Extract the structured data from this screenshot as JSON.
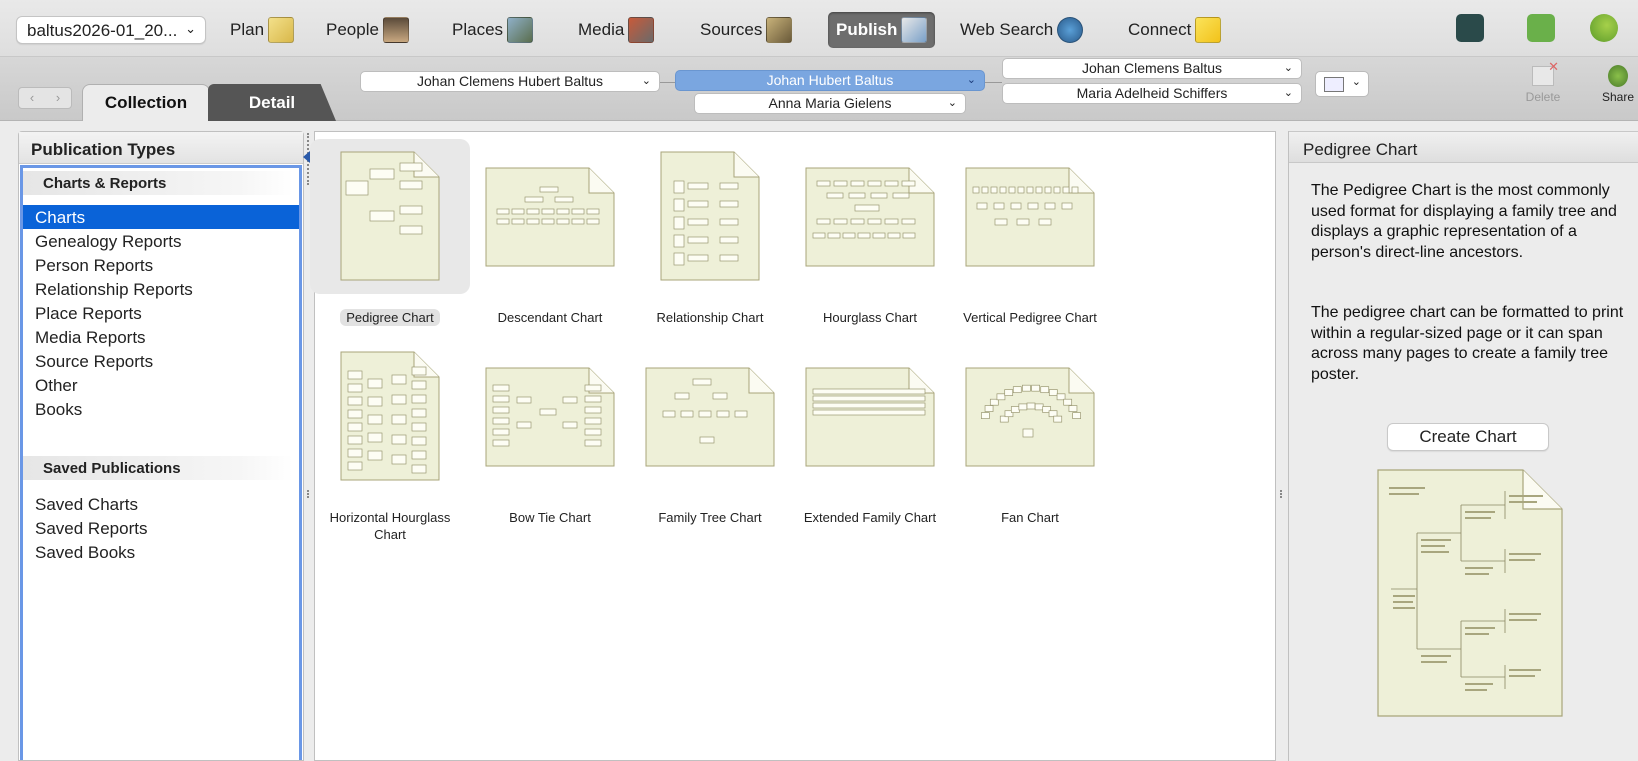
{
  "toolbar": {
    "file_name": "baltus2026-01_20...",
    "modules": [
      {
        "label": "Plan",
        "icon": "plan-icon"
      },
      {
        "label": "People",
        "icon": "people-icon"
      },
      {
        "label": "Places",
        "icon": "places-icon"
      },
      {
        "label": "Media",
        "icon": "media-icon"
      },
      {
        "label": "Sources",
        "icon": "sources-icon"
      },
      {
        "label": "Publish",
        "icon": "publish-icon",
        "active": true
      },
      {
        "label": "Web Search",
        "icon": "web-search-icon"
      },
      {
        "label": "Connect",
        "icon": "connect-icon"
      }
    ]
  },
  "subbar": {
    "tabs": [
      "Collection",
      "Detail"
    ],
    "active_tab": "Collection",
    "person_main": "Johan Hubert Baltus",
    "person_left": "Johan Clemens Hubert Baltus",
    "spouse": "Anna Maria Gielens",
    "father": "Johan Clemens Baltus",
    "mother": "Maria Adelheid Schiffers",
    "delete_label": "Delete",
    "share_label": "Share"
  },
  "publication_types": {
    "header": "Publication Types",
    "section1": "Charts & Reports",
    "items": [
      "Charts",
      "Genealogy Reports",
      "Person Reports",
      "Relationship Reports",
      "Place Reports",
      "Media Reports",
      "Source Reports",
      "Other",
      "Books"
    ],
    "selected": "Charts",
    "section2": "Saved Publications",
    "saved_items": [
      "Saved Charts",
      "Saved Reports",
      "Saved Books"
    ]
  },
  "charts": [
    {
      "label": "Pedigree Chart",
      "selected": true
    },
    {
      "label": "Descendant Chart"
    },
    {
      "label": "Relationship Chart"
    },
    {
      "label": "Hourglass Chart"
    },
    {
      "label": "Vertical Pedigree Chart"
    },
    {
      "label": "Horizontal Hourglass Chart"
    },
    {
      "label": "Bow Tie Chart"
    },
    {
      "label": "Family Tree Chart"
    },
    {
      "label": "Extended Family Chart"
    },
    {
      "label": "Fan Chart"
    }
  ],
  "detail": {
    "title": "Pedigree Chart",
    "paragraph1": "The Pedigree Chart is the most commonly used format for displaying a family tree and displays a graphic representation of a person's direct-line ancestors.",
    "paragraph2": "The pedigree chart can be formatted to print within a regular-sized page or it can span across many pages to create a family tree poster.",
    "button": "Create Chart"
  },
  "colors": {
    "selection_blue": "#0a63d8",
    "panel_border_blue": "#6a97e6",
    "thumb_paper": "#eef0d8",
    "thumb_border": "#a8a57a"
  }
}
